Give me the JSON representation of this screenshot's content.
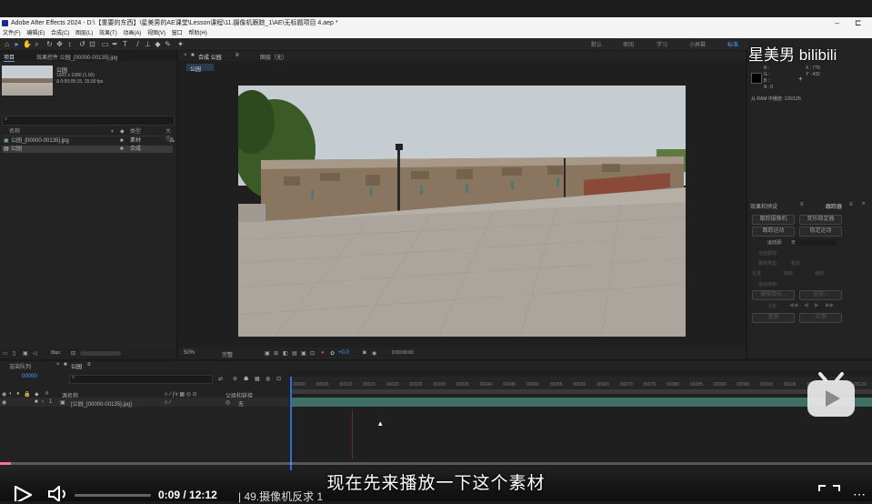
{
  "title_bar": {
    "title": "Adobe After Effects 2024 - D:\\【重要的东西】\\星美男的AE课堂\\Lesson课程\\11.摄像机跟踪_1\\AE\\无标题项目 4.aep *",
    "minimize": "–",
    "close": "⊏"
  },
  "menu": [
    "文件(F)",
    "编辑(E)",
    "合成(C)",
    "图层(L)",
    "效果(T)",
    "动画(A)",
    "视图(V)",
    "窗口",
    "帮助(H)"
  ],
  "workspaces": [
    "默认",
    "审阅",
    "学习",
    "小屏幕",
    "标准"
  ],
  "project": {
    "tab_label": "项目",
    "tab2_label": "效果控件 公园_[00000-00135].jpg",
    "item_name": "公园",
    "item_info1": "1920 x 1080 (1.00)",
    "item_info2": "Δ 0:00:05:15, 25.00 fps",
    "col_name": "名称",
    "col_type": "类型",
    "col_size": "大小",
    "rows": [
      {
        "name": "公园_[00000-00135].jpg",
        "type": "素材"
      },
      {
        "name": "公园",
        "type": "合成"
      }
    ],
    "bpc": "8bpc"
  },
  "composition": {
    "tab_label": "合成 公园",
    "tab_menu": "≡",
    "layer_tab": "图层（无）",
    "subtab": "公园",
    "zoom": "50%",
    "quality": "完整",
    "timecode": "0:00:00:00",
    "exposure": "+0.0"
  },
  "info": {
    "r": "R :",
    "g": "G :",
    "b": "B :",
    "a": "A : 0",
    "x": "X : 776",
    "y": "Y : 432",
    "ram": "从 RAM 中播放: 126/126"
  },
  "tracker": {
    "tab1": "效果和预设",
    "tab2": "跟踪器",
    "btn_camera": "跟踪摄像机",
    "btn_warp": "变形稳定器",
    "btn_motion": "跟踪运动",
    "btn_stabilize": "稳定运动",
    "source_label": "运动源:",
    "source_value": "无",
    "current_track": "当前跟踪:",
    "track_type": "跟踪类型:",
    "track_type_value": "稳定",
    "position": "位置",
    "rotation": "旋转",
    "scale": "缩放",
    "motion_target": "运动目标:",
    "edit_target": "编辑目标...",
    "options": "选项...",
    "analyze": "分析:",
    "reset": "重置",
    "apply": "应用"
  },
  "timeline": {
    "render_queue": "渲染队列",
    "tab_label": "公园",
    "timecode": "00000",
    "col_source": "源名称",
    "col_parent": "父级和链接",
    "layer_num": "1",
    "layer_name": "[公园_[00000-00135].jpg]",
    "parent_value": "无",
    "ticks": [
      "00000",
      "00005",
      "00010",
      "00015",
      "00020",
      "00025",
      "00030",
      "00035",
      "00040",
      "00045",
      "00050",
      "00055",
      "00060",
      "00065",
      "00070",
      "00075",
      "00080",
      "00085",
      "00090",
      "00095",
      "00100",
      "00105",
      "00110",
      "00115",
      "00120",
      "00125"
    ]
  },
  "video_player": {
    "subtitle": "现在先来播放一下这个素材",
    "current_time": "0:09",
    "total_time": "12:12",
    "chapter": "49.摄像机反求 1",
    "progress": 0.012,
    "watermark": "星美男  bilibili",
    "accent": "#fb7299"
  }
}
